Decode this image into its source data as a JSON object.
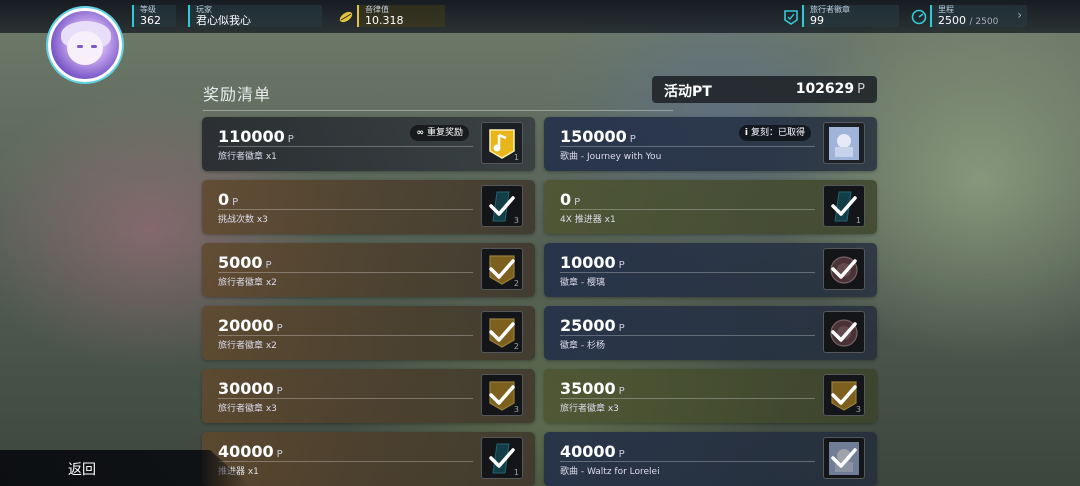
{
  "topbar": {
    "level": {
      "label": "等级",
      "value": "362"
    },
    "player": {
      "label": "玩家",
      "value": "君心似我心"
    },
    "rhythm": {
      "label": "音律值",
      "value": "10.318"
    },
    "badge": {
      "label": "旅行者徽章",
      "value": "99"
    },
    "mileage": {
      "label": "里程",
      "value": "2500",
      "max": "/ 2500"
    }
  },
  "section_title": "奖励清单",
  "activity_pt": {
    "label": "活动PT",
    "value": "102629",
    "unit": "P"
  },
  "point_unit": "P",
  "rewards_left": [
    {
      "points": "110000",
      "desc": "旅行者徽章 x1",
      "tag": "重复奖励",
      "tag_icon": "∞",
      "count": "1",
      "icon": "music-note-icon",
      "claimed": false
    },
    {
      "points": "0",
      "desc": "挑战次数 x3",
      "count": "3",
      "icon": "ticket-icon",
      "claimed": true
    },
    {
      "points": "5000",
      "desc": "旅行者徽章 x2",
      "count": "2",
      "icon": "badge-icon",
      "claimed": true
    },
    {
      "points": "20000",
      "desc": "旅行者徽章 x2",
      "count": "2",
      "icon": "badge-icon",
      "claimed": true
    },
    {
      "points": "30000",
      "desc": "旅行者徽章 x3",
      "count": "3",
      "icon": "badge-icon",
      "claimed": true
    },
    {
      "points": "40000",
      "desc": "推进器 x1",
      "count": "1",
      "icon": "ticket-icon",
      "claimed": true
    }
  ],
  "rewards_right": [
    {
      "points": "150000",
      "desc": "歌曲 - Journey with You",
      "tag": "复刻：已取得",
      "tag_icon": "i",
      "count": "",
      "icon": "song-cover-icon",
      "claimed": false
    },
    {
      "points": "0",
      "desc": "4X 推进器 x1",
      "count": "1",
      "icon": "ticket-icon",
      "claimed": true
    },
    {
      "points": "10000",
      "desc": "徽章 - 樱璃",
      "count": "",
      "icon": "emblem-icon",
      "claimed": true
    },
    {
      "points": "25000",
      "desc": "徽章 - 杉杨",
      "count": "",
      "icon": "emblem-icon",
      "claimed": true
    },
    {
      "points": "35000",
      "desc": "旅行者徽章 x3",
      "count": "3",
      "icon": "badge-icon",
      "claimed": true
    },
    {
      "points": "40000",
      "desc": "歌曲 - Waltz for Lorelei",
      "count": "",
      "icon": "song-cover-icon",
      "claimed": true
    }
  ],
  "back_label": "返回",
  "colors": {
    "accent": "#33c9d6",
    "yellow": "#e5c33a"
  }
}
